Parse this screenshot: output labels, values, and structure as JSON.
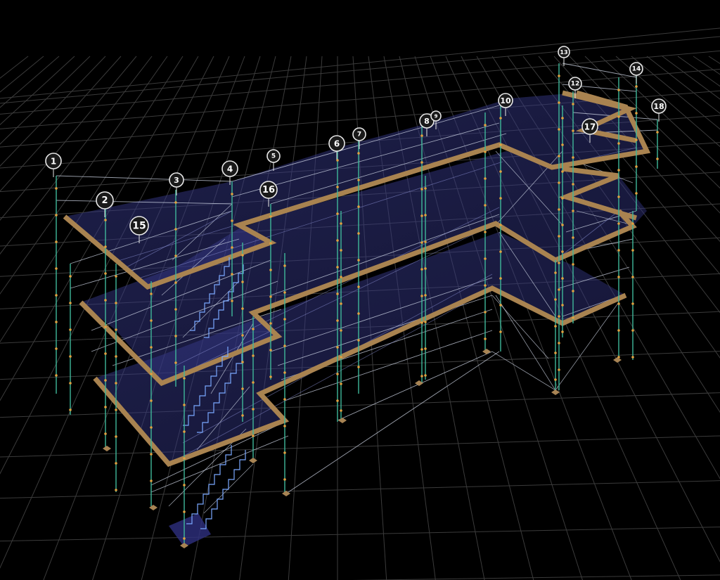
{
  "viewer": {
    "background": "#000000",
    "colors": {
      "grid": "#3b3b3b",
      "deck": "#3c3f8c",
      "ledger_outline": "#a98350",
      "standard": "#3fb89a",
      "brace": "#cfd6e6",
      "stair": "#7aa8ff",
      "base_plate": "#a88454",
      "marker_ring": "#e8e8e8"
    }
  },
  "markers": [
    {
      "id": "1",
      "label": "1"
    },
    {
      "id": "2",
      "label": "2"
    },
    {
      "id": "3",
      "label": "3"
    },
    {
      "id": "4",
      "label": "4"
    },
    {
      "id": "5",
      "label": "5"
    },
    {
      "id": "6",
      "label": "6"
    },
    {
      "id": "7",
      "label": "7"
    },
    {
      "id": "8",
      "label": "8"
    },
    {
      "id": "9",
      "label": "9"
    },
    {
      "id": "10",
      "label": "10"
    },
    {
      "id": "12",
      "label": "12"
    },
    {
      "id": "13",
      "label": "13"
    },
    {
      "id": "14",
      "label": "14"
    },
    {
      "id": "15",
      "label": "15"
    },
    {
      "id": "16",
      "label": "16"
    },
    {
      "id": "17",
      "label": "17"
    },
    {
      "id": "18",
      "label": "18"
    }
  ]
}
